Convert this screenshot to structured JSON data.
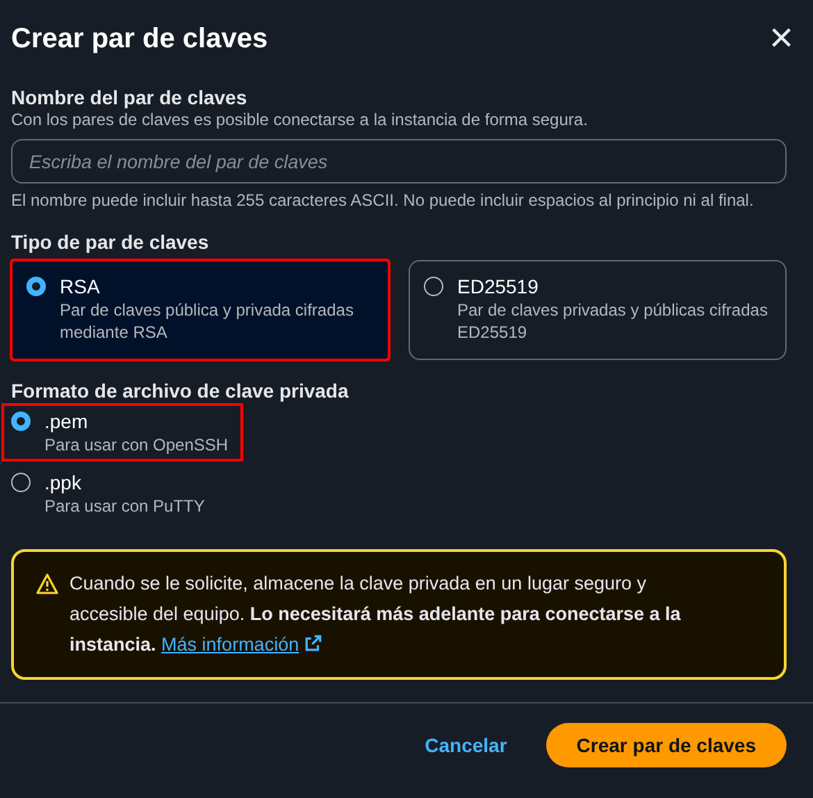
{
  "dialog": {
    "title": "Crear par de claves",
    "close": "×"
  },
  "name_field": {
    "label": "Nombre del par de claves",
    "description": "Con los pares de claves es posible conectarse a la instancia de forma segura.",
    "placeholder": "Escriba el nombre del par de claves",
    "hint": "El nombre puede incluir hasta 255 caracteres ASCII. No puede incluir espacios al principio ni al final."
  },
  "key_type": {
    "label": "Tipo de par de claves",
    "options": [
      {
        "label": "RSA",
        "description": "Par de claves pública y privada cifradas mediante RSA",
        "selected": true,
        "highlighted": true
      },
      {
        "label": "ED25519",
        "description": "Par de claves privadas y públicas cifradas ED25519",
        "selected": false,
        "highlighted": false
      }
    ]
  },
  "file_format": {
    "label": "Formato de archivo de clave privada",
    "options": [
      {
        "label": ".pem",
        "description": "Para usar con OpenSSH",
        "selected": true,
        "highlighted": true
      },
      {
        "label": ".ppk",
        "description": "Para usar con PuTTY",
        "selected": false,
        "highlighted": false
      }
    ]
  },
  "alert": {
    "text": "Cuando se le solicite, almacene la clave privada en un lugar seguro y accesible del equipo. **Lo necesitará más adelante para conectarse a la instancia.**",
    "link": "Más información"
  },
  "buttons": [
    {
      "label": "Cancelar",
      "kind": "link"
    },
    {
      "label": "Crear par de claves",
      "kind": "primary"
    }
  ]
}
